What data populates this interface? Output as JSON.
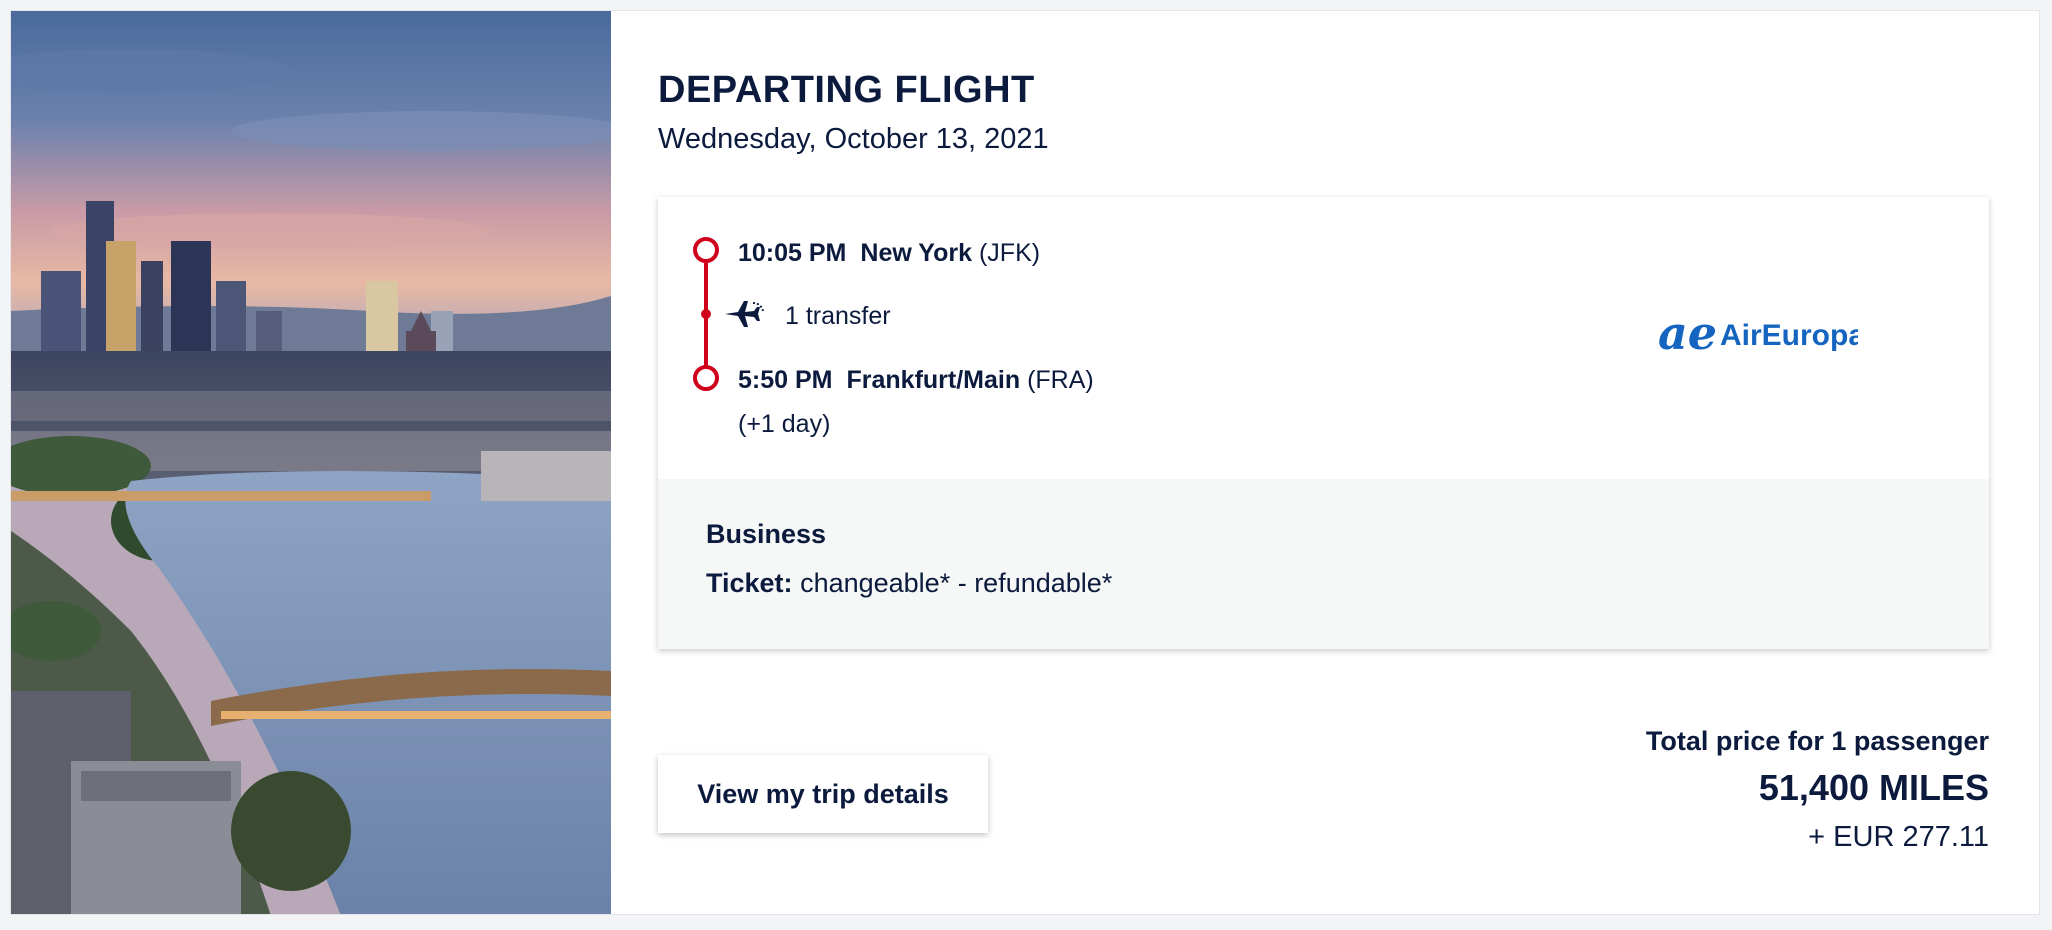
{
  "heading": {
    "title": "DEPARTING FLIGHT",
    "date": "Wednesday, October 13, 2021"
  },
  "itinerary": {
    "departure": {
      "time": "10:05 PM",
      "city": "New York",
      "code": "(JFK)"
    },
    "transfer": "1 transfer",
    "arrival": {
      "time": "5:50 PM",
      "city": "Frankfurt/Main",
      "code": "(FRA)",
      "day_offset": "(+1 day)"
    },
    "airline": {
      "logo_mark": "ae",
      "name": "AirEuropa"
    }
  },
  "fare": {
    "cabin": "Business",
    "ticket_label": "Ticket:",
    "ticket_conditions": "changeable* - refundable*"
  },
  "actions": {
    "details_label": "View my trip details"
  },
  "price": {
    "label": "Total price for 1 passenger",
    "miles": "51,400 MILES",
    "cash": "+ EUR 277.11"
  },
  "icons": {
    "timeline_dot": "circle-outline-icon",
    "transfer": "airplane-connection-icon"
  },
  "colors": {
    "text": "#0b1a3d",
    "timeline": "#d0021b",
    "airline_brand": "#1565c0",
    "fare_background": "#f6f7f7"
  }
}
